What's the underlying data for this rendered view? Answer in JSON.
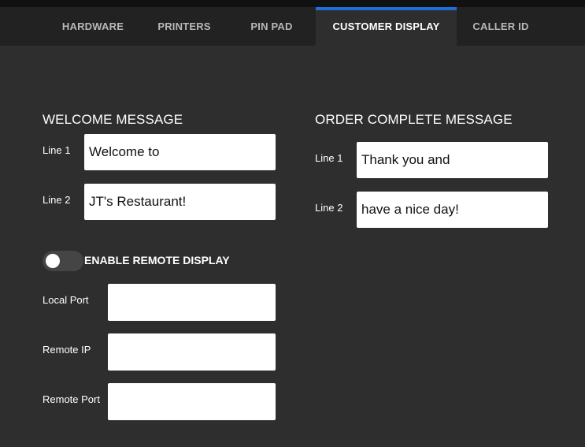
{
  "tabs": [
    {
      "label": "HARDWARE"
    },
    {
      "label": "PRINTERS"
    },
    {
      "label": "PIN PAD"
    },
    {
      "label": "CUSTOMER DISPLAY",
      "active": true
    },
    {
      "label": "CALLER ID"
    }
  ],
  "welcome": {
    "title": "WELCOME MESSAGE",
    "line1_label": "Line 1",
    "line1_value": "Welcome to",
    "line2_label": "Line 2",
    "line2_value": "JT's Restaurant!"
  },
  "order_complete": {
    "title": "ORDER COMPLETE MESSAGE",
    "line1_label": "Line 1",
    "line1_value": "Thank you and",
    "line2_label": "Line 2",
    "line2_value": "have a nice day!"
  },
  "remote_display": {
    "toggle_label": "ENABLE REMOTE DISPLAY",
    "enabled": false,
    "local_port_label": "Local Port",
    "local_port_value": "",
    "remote_ip_label": "Remote IP",
    "remote_ip_value": "",
    "remote_port_label": "Remote Port",
    "remote_port_value": ""
  },
  "colors": {
    "background": "#2e2e2e",
    "tab_bar": "#222222",
    "active_tab_indicator": "#1e6fd9"
  }
}
